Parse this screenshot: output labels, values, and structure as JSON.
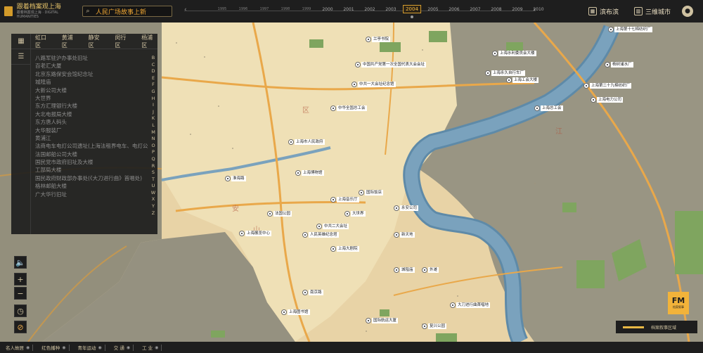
{
  "app": {
    "title": "跟着档案观上海",
    "subtitle": "跟着档案观上海 · DIGITAL HUMANITIES"
  },
  "search": {
    "value": "人民广场故事上新"
  },
  "timeline": {
    "years": [
      "1995",
      "1996",
      "1997",
      "1998",
      "1999",
      "2000",
      "2001",
      "2002",
      "2003",
      "2004",
      "2005",
      "2006",
      "2007",
      "2008",
      "2009",
      "2010"
    ],
    "active_year": "2004"
  },
  "nav": {
    "river_label": "滨布滨",
    "city_label": "三维城市"
  },
  "districts": [
    "虹口区",
    "黄浦区",
    "静安区",
    "闵行区",
    "杨浦区"
  ],
  "sidebar": {
    "items": [
      "八路军驻沪办事处旧址",
      "百老汇大厦",
      "北京东路保安会馆纪念址",
      "城隍庙",
      "大新公司大楼",
      "大世界",
      "东方汇理银行大楼",
      "大北电报局大楼",
      "东方唐人码头",
      "大华服装厂",
      "黄浦江",
      "法商电车电灯公司遗址(上海法租界电车、电灯公司工人罢工斗争地遗址)",
      "法国邮船公司大楼",
      "国民党市政府旧址及大楼",
      "工部局大楼",
      "国民政府财政部办事处(《大刀进行曲》首唱处)",
      "格林邮船大楼",
      "广大华行旧址"
    ],
    "alphabet": [
      "B",
      "C",
      "D",
      "E",
      "F",
      "G",
      "H",
      "I",
      "J",
      "K",
      "L",
      "M",
      "N",
      "O",
      "P",
      "Q",
      "R",
      "S",
      "T",
      "U",
      "W",
      "X",
      "Y",
      "Z"
    ]
  },
  "bottom": {
    "categories": [
      "名人故居",
      "红色播种",
      "青年运动",
      "交  通",
      "工  业"
    ]
  },
  "brand": {
    "fm": "FM",
    "fm_sub": "档案叙事",
    "accent": "#f2b33a"
  },
  "legend": {
    "label": "档案叙事区域"
  },
  "map": {
    "river_label": "江",
    "labels": [
      "上海第十七棉纺织厂",
      "中国共产党第一次全国代表大会会址",
      "上海水利委员会大楼",
      "上海第二十九棉纺织厂",
      "中共一大会址纪念馆",
      "兰亭书院",
      "中华全国总工会",
      "上海永久自行车厂",
      "上海工会大楼",
      "上海总工会",
      "上海市人民政府",
      "上海博物馆",
      "国际饭店",
      "上海音乐厅",
      "永安公司",
      "大世界",
      "中共二大会址",
      "人民英雄纪念塔",
      "法国公园",
      "淮海路",
      "新天地",
      "上海展览中心",
      "上海大剧院",
      "城隍庙",
      "外滩",
      "南京路",
      "上海图书馆",
      "国际航运大厦",
      "复兴公园",
      "大刀进行曲首唱地",
      "上海电力公司",
      "杨树浦水厂"
    ]
  }
}
